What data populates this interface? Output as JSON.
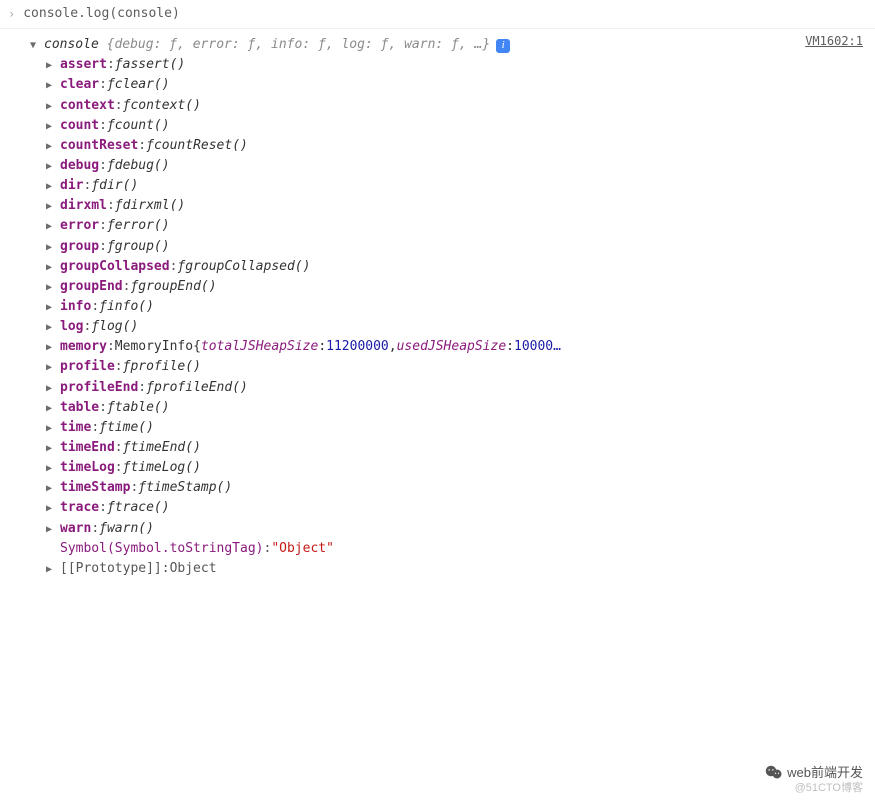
{
  "input": {
    "prompt": "›",
    "code": "console.log(console)"
  },
  "source_link": "VM1602:1",
  "header": {
    "name": "console",
    "preview_keys": [
      "debug",
      "error",
      "info",
      "log",
      "warn"
    ],
    "preview_fval": "ƒ",
    "preview_rest": "…",
    "info_glyph": "i"
  },
  "props": [
    {
      "key": "assert",
      "type": "fn",
      "fn": "assert()",
      "bold": true,
      "arrow": true
    },
    {
      "key": "clear",
      "type": "fn",
      "fn": "clear()",
      "bold": true,
      "arrow": true
    },
    {
      "key": "context",
      "type": "fn",
      "fn": "context()",
      "bold": true,
      "arrow": true
    },
    {
      "key": "count",
      "type": "fn",
      "fn": "count()",
      "bold": true,
      "arrow": true
    },
    {
      "key": "countReset",
      "type": "fn",
      "fn": "countReset()",
      "bold": true,
      "arrow": true
    },
    {
      "key": "debug",
      "type": "fn",
      "fn": "debug()",
      "bold": true,
      "arrow": true
    },
    {
      "key": "dir",
      "type": "fn",
      "fn": "dir()",
      "bold": true,
      "arrow": true
    },
    {
      "key": "dirxml",
      "type": "fn",
      "fn": "dirxml()",
      "bold": true,
      "arrow": true
    },
    {
      "key": "error",
      "type": "fn",
      "fn": "error()",
      "bold": true,
      "arrow": true
    },
    {
      "key": "group",
      "type": "fn",
      "fn": "group()",
      "bold": true,
      "arrow": true
    },
    {
      "key": "groupCollapsed",
      "type": "fn",
      "fn": "groupCollapsed()",
      "bold": true,
      "arrow": true
    },
    {
      "key": "groupEnd",
      "type": "fn",
      "fn": "groupEnd()",
      "bold": true,
      "arrow": true
    },
    {
      "key": "info",
      "type": "fn",
      "fn": "info()",
      "bold": true,
      "arrow": true
    },
    {
      "key": "log",
      "type": "fn",
      "fn": "log()",
      "bold": true,
      "arrow": true
    },
    {
      "key": "memory",
      "type": "mem",
      "obj_type": "MemoryInfo",
      "p1_key": "totalJSHeapSize",
      "p1_val": "11200000",
      "p2_key": "usedJSHeapSize",
      "p2_val": "10000…",
      "bold": true,
      "arrow": true
    },
    {
      "key": "profile",
      "type": "fn",
      "fn": "profile()",
      "bold": true,
      "arrow": true
    },
    {
      "key": "profileEnd",
      "type": "fn",
      "fn": "profileEnd()",
      "bold": true,
      "arrow": true
    },
    {
      "key": "table",
      "type": "fn",
      "fn": "table()",
      "bold": true,
      "arrow": true
    },
    {
      "key": "time",
      "type": "fn",
      "fn": "time()",
      "bold": true,
      "arrow": true
    },
    {
      "key": "timeEnd",
      "type": "fn",
      "fn": "timeEnd()",
      "bold": true,
      "arrow": true
    },
    {
      "key": "timeLog",
      "type": "fn",
      "fn": "timeLog()",
      "bold": true,
      "arrow": true
    },
    {
      "key": "timeStamp",
      "type": "fn",
      "fn": "timeStamp()",
      "bold": true,
      "arrow": true
    },
    {
      "key": "trace",
      "type": "fn",
      "fn": "trace()",
      "bold": true,
      "arrow": true
    },
    {
      "key": "warn",
      "type": "fn",
      "fn": "warn()",
      "bold": true,
      "arrow": true
    },
    {
      "key": "Symbol(Symbol.toStringTag)",
      "type": "str",
      "str": "\"Object\"",
      "bold": false,
      "arrow": false
    },
    {
      "key": "[[Prototype]]",
      "type": "proto",
      "val": "Object",
      "bold": false,
      "arrow": true,
      "gray": true
    }
  ],
  "fsym": "ƒ",
  "watermark": {
    "text": "web前端开发",
    "sub": "@51CTO博客"
  }
}
